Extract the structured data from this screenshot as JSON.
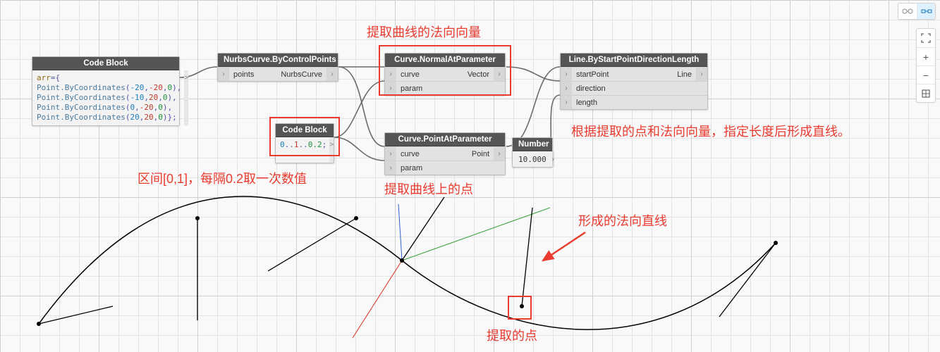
{
  "toolbar": {
    "view_mode_a_icon": "glasses-icon",
    "view_mode_b_icon": "node-graph-icon",
    "fit_icon": "fit-icon",
    "zoom_in": "+",
    "zoom_out": "−",
    "zoom_extents_icon": "extents-icon"
  },
  "nodes": {
    "codeBlock1": {
      "title": "Code Block",
      "code_lines": [
        {
          "raw": "arr={"
        },
        {
          "raw": "Point.ByCoordinates(-20,-20,0),"
        },
        {
          "raw": "Point.ByCoordinates(-10,20,0),"
        },
        {
          "raw": "Point.ByCoordinates(0,-20,0),"
        },
        {
          "raw": "Point.ByCoordinates(20,20,0)};"
        }
      ],
      "out_glyph": ">"
    },
    "nurbs": {
      "title": "NurbsCurve.ByControlPoints",
      "in_port": "points",
      "out_port": "NurbsCurve"
    },
    "codeBlock2": {
      "title": "Code Block",
      "code": "0..1..0.2;",
      "out_glyph": ">"
    },
    "normal": {
      "title": "Curve.NormalAtParameter",
      "in_port_1": "curve",
      "in_port_2": "param",
      "out_port": "Vector"
    },
    "point": {
      "title": "Curve.PointAtParameter",
      "in_port_1": "curve",
      "in_port_2": "param",
      "out_port": "Point"
    },
    "line": {
      "title": "Line.ByStartPointDirectionLength",
      "in_port_1": "startPoint",
      "in_port_2": "direction",
      "in_port_3": "length",
      "out_port": "Line"
    },
    "number": {
      "title": "Number",
      "value": "10.000"
    }
  },
  "annotations": {
    "normal_label": "提取曲线的法向向量",
    "interval_label": "区间[0,1]，每隔0.2取一次数值",
    "point_label": "提取曲线上的点",
    "line_label": "根据提取的点和法向向量，指定长度后形成直线。",
    "normal_line_label": "形成的法向直线",
    "sample_point_label": "提取的点"
  }
}
